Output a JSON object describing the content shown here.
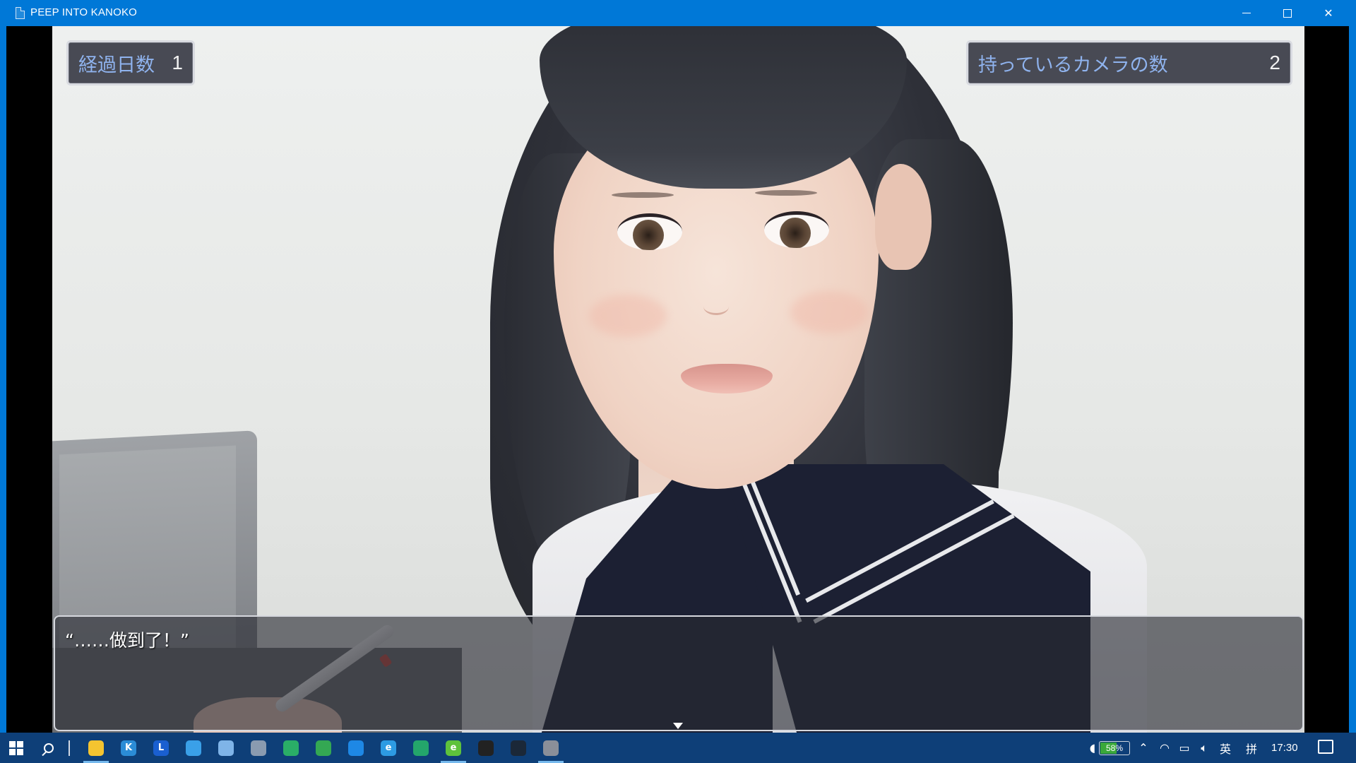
{
  "window": {
    "title": "PEEP INTO KANOKO"
  },
  "hud": {
    "days_label": "経過日数",
    "days_value": "1",
    "cameras_label": "持っているカメラの数",
    "cameras_value": "2"
  },
  "dialogue": {
    "text": "“……做到了！”"
  },
  "taskbar": {
    "apps": [
      {
        "icon": "file-explorer-icon",
        "color": "#f4c430",
        "glyph": "",
        "active": true
      },
      {
        "icon": "k-app-icon",
        "color": "#2b8cd6",
        "glyph": "K",
        "active": false
      },
      {
        "icon": "l-app-icon",
        "color": "#1a5fd0",
        "glyph": "L",
        "active": false
      },
      {
        "icon": "browser-icon",
        "color": "#3aa0e8",
        "glyph": "",
        "active": false
      },
      {
        "icon": "cloud-icon",
        "color": "#7fb4e8",
        "glyph": "",
        "active": false
      },
      {
        "icon": "chat-app-icon",
        "color": "#8a9bb0",
        "glyph": "",
        "active": false
      },
      {
        "icon": "wechat-icon",
        "color": "#2aae67",
        "glyph": "",
        "active": false
      },
      {
        "icon": "green-app-icon",
        "color": "#34a853",
        "glyph": "",
        "active": false
      },
      {
        "icon": "media-app-icon",
        "color": "#1e88e5",
        "glyph": "",
        "active": false
      },
      {
        "icon": "edge-legacy-icon",
        "color": "#2d9be3",
        "glyph": "e",
        "active": false
      },
      {
        "icon": "spreadsheet-icon",
        "color": "#24a66b",
        "glyph": "",
        "active": false
      },
      {
        "icon": "green-browser-icon",
        "color": "#5ec23c",
        "glyph": "e",
        "active": true
      },
      {
        "icon": "qq-icon",
        "color": "#222222",
        "glyph": "",
        "active": false
      },
      {
        "icon": "steam-icon",
        "color": "#1b2838",
        "glyph": "",
        "active": false
      },
      {
        "icon": "game-window-icon",
        "color": "#8a8f99",
        "glyph": "",
        "active": true
      }
    ],
    "battery_percent": 58,
    "battery_text": "58%",
    "ime_lang": "英",
    "ime_mode": "拼",
    "clock": "17:30"
  }
}
